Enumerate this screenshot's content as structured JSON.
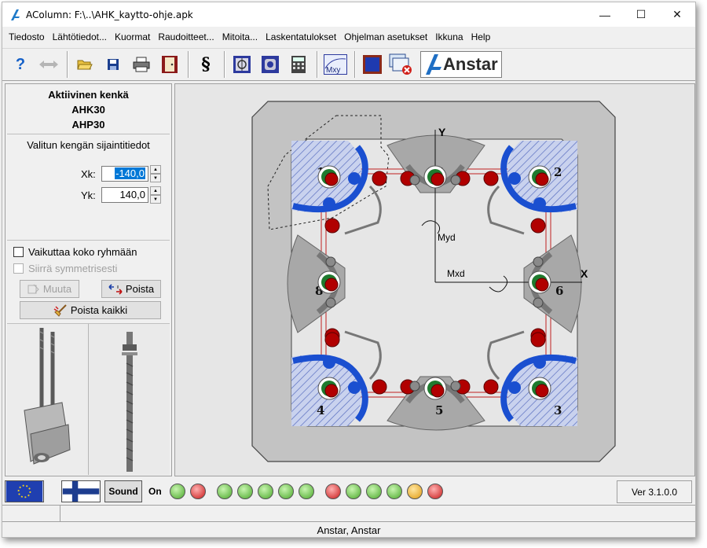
{
  "window": {
    "title": "AColumn:  F:\\..\\AHK_kaytto-ohje.apk",
    "minimize": "—",
    "maximize": "☐",
    "close": "✕"
  },
  "menu": [
    "Tiedosto",
    "Lähtötiedot...",
    "Kuormat",
    "Raudoitteet...",
    "Mitoita...",
    "Laskentatulokset",
    "Ohjelman asetukset",
    "Ikkuna",
    "Help"
  ],
  "toolbar": {
    "help": "?",
    "section": "§",
    "mxy": "Mxy",
    "brand": "Anstar"
  },
  "left_panel": {
    "active_title": "Aktiivinen kenkä",
    "active_type1": "AHK30",
    "active_type2": "AHP30",
    "location_title": "Valitun kengän sijaintitiedot",
    "xk_label": "Xk:",
    "xk_value": "-140,0",
    "yk_label": "Yk:",
    "yk_value": "140,0",
    "affects_group": "Vaikuttaa koko ryhmään",
    "move_symmetric": "Siirrä symmetrisesti",
    "modify_button": "Muuta",
    "delete_button": "Poista",
    "delete_all_button": "Poista kaikki"
  },
  "drawing": {
    "axis_y": "Y",
    "axis_x": "X",
    "moment_y": "Myd",
    "moment_x": "Mxd",
    "shoe_labels": [
      "1",
      "2",
      "3",
      "4",
      "5",
      "6",
      "7",
      "8"
    ]
  },
  "status": {
    "sound_label": "Sound",
    "on_label": "On",
    "version": "Ver 3.1.0.0",
    "footer": "Anstar,  Anstar"
  },
  "colors": {
    "blue_shoe": "#1a4fd0",
    "gray_shoe": "#a8a8a8",
    "rebar_red": "#b10000",
    "bolt_green": "#1f7a2e",
    "selection": "#0078d7"
  },
  "leds": [
    "green",
    "red",
    "green",
    "green",
    "green",
    "green",
    "green",
    "red",
    "green",
    "green",
    "green",
    "orange",
    "red"
  ]
}
